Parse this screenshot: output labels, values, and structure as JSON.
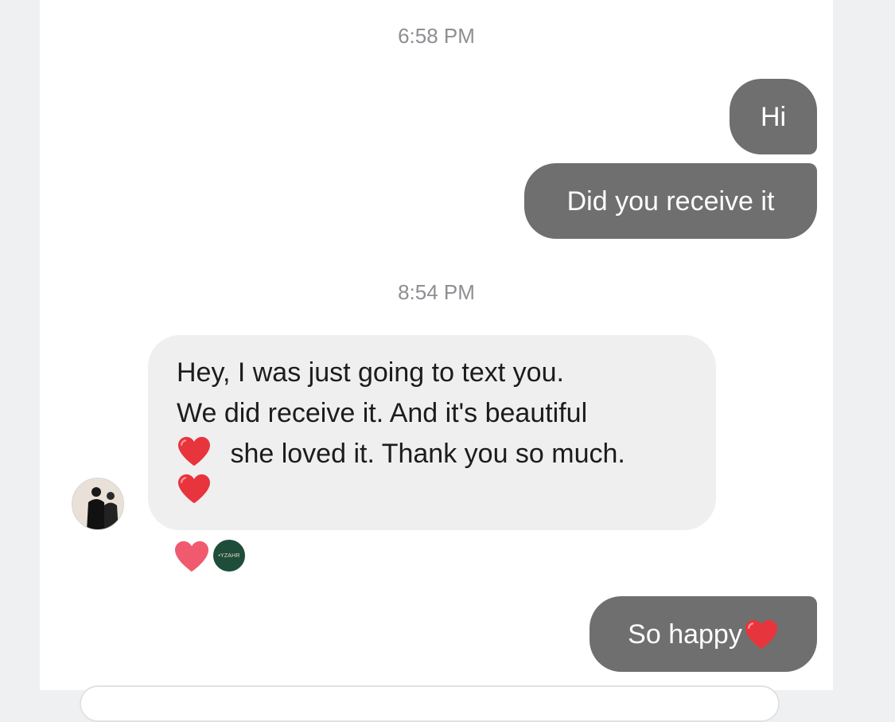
{
  "timestamps": [
    "6:58 PM",
    "8:54 PM"
  ],
  "outgoing": {
    "msg1": "Hi",
    "msg2": "Did you receive it",
    "msg3": "So happy"
  },
  "incoming": {
    "line1": "Hey, I was just going to text you.",
    "line2": "We did receive it. And it's beautiful",
    "line3": "she loved it. Thank you so much."
  },
  "reactions": {
    "logo_text": "•YZAHR"
  },
  "colors": {
    "outgoing_bubble": "#6f6f6f",
    "incoming_bubble": "#efefef",
    "heart": "#e8343d",
    "reaction_heart": "#ef5a6f",
    "logo_bg": "#1e4d3a"
  },
  "icons": [
    "red-heart-emoji",
    "heart-reaction-icon",
    "brand-logo-avatar",
    "user-avatar"
  ]
}
